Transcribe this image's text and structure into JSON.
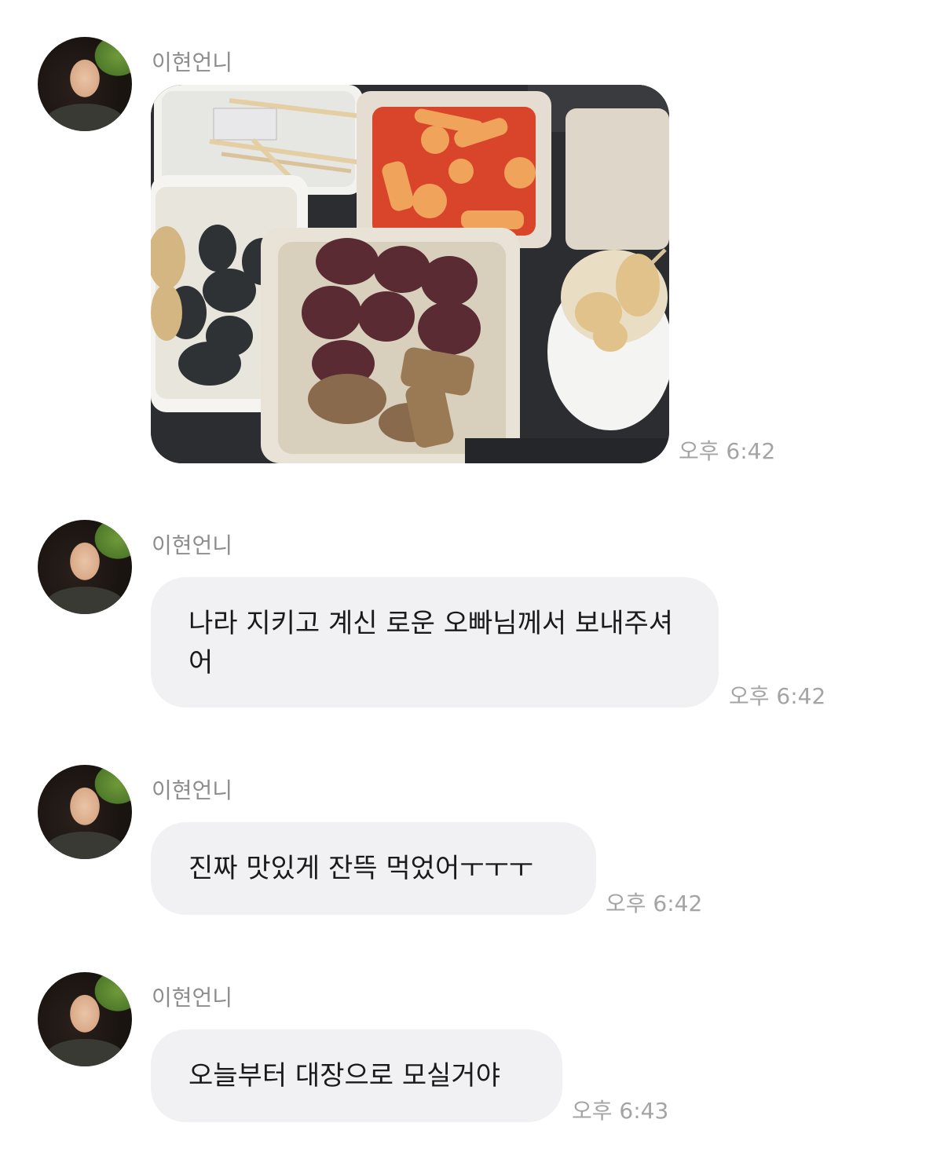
{
  "messages": [
    {
      "sender": "이현언니",
      "type": "image",
      "time": "오후 6:42"
    },
    {
      "sender": "이현언니",
      "type": "text",
      "text": "나라 지키고 계신 로운 오빠님께서 보내주셔어",
      "time": "오후 6:42"
    },
    {
      "sender": "이현언니",
      "type": "text",
      "text": "진짜 맛있게 잔뜩 먹었어ㅜㅜㅜ",
      "time": "오후 6:42"
    },
    {
      "sender": "이현언니",
      "type": "text",
      "text": "오늘부터 대장으로 모실거야",
      "time": "오후 6:43"
    }
  ],
  "colors": {
    "background": "#ffffff",
    "bubble": "#f1f1f3",
    "sender_text": "#8d8d8d",
    "time_text": "#a4a4a4",
    "message_text": "#1a1a1a"
  }
}
